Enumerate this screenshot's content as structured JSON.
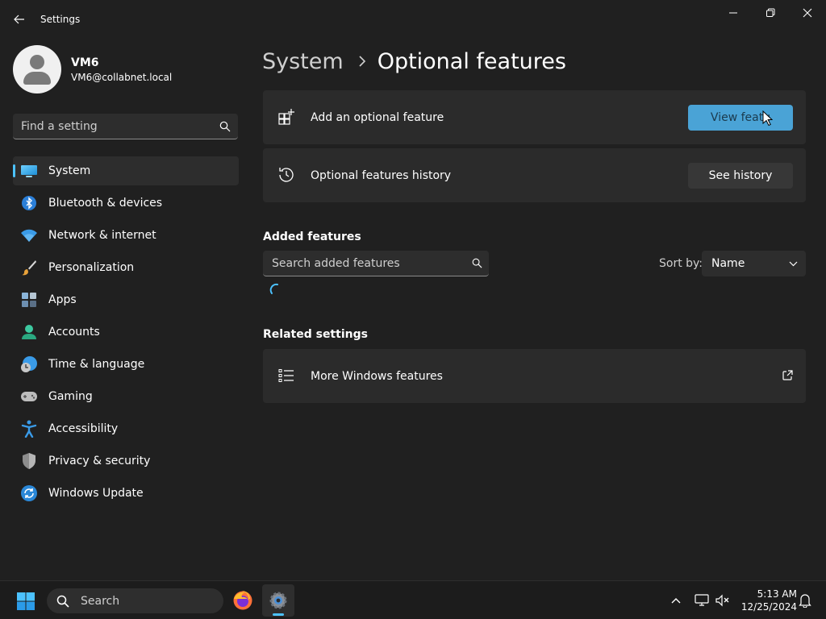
{
  "window": {
    "title": "Settings"
  },
  "profile": {
    "name": "VM6",
    "email": "VM6@collabnet.local"
  },
  "search": {
    "placeholder": "Find a setting"
  },
  "sidebar": {
    "items": [
      {
        "label": "System",
        "icon": "monitor-icon"
      },
      {
        "label": "Bluetooth & devices",
        "icon": "bluetooth-icon"
      },
      {
        "label": "Network & internet",
        "icon": "wifi-icon"
      },
      {
        "label": "Personalization",
        "icon": "paintbrush-icon"
      },
      {
        "label": "Apps",
        "icon": "apps-icon"
      },
      {
        "label": "Accounts",
        "icon": "person-icon"
      },
      {
        "label": "Time & language",
        "icon": "globe-clock-icon"
      },
      {
        "label": "Gaming",
        "icon": "gamepad-icon"
      },
      {
        "label": "Accessibility",
        "icon": "accessibility-icon"
      },
      {
        "label": "Privacy & security",
        "icon": "shield-icon"
      },
      {
        "label": "Windows Update",
        "icon": "update-icon"
      }
    ]
  },
  "breadcrumb": {
    "parent": "System",
    "current": "Optional features"
  },
  "cards": {
    "add": {
      "label": "Add an optional feature",
      "button": "View featu"
    },
    "history": {
      "label": "Optional features history",
      "button": "See history"
    }
  },
  "added_features": {
    "title": "Added features",
    "search_placeholder": "Search added features",
    "sort_label": "Sort by:",
    "sort_value": "Name"
  },
  "related": {
    "title": "Related settings",
    "more_label": "More Windows features"
  },
  "taskbar": {
    "search_label": "Search",
    "time": "5:13 AM",
    "date": "12/25/2024"
  },
  "colors": {
    "accent": "#4cc2ff",
    "background": "#202020",
    "card": "#2b2b2b"
  }
}
